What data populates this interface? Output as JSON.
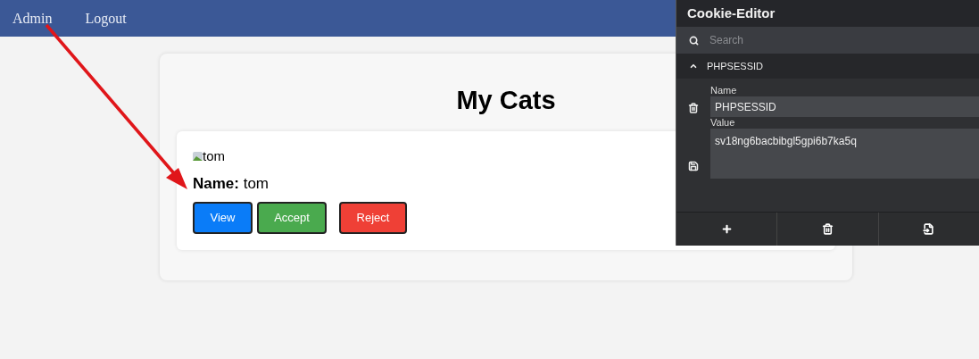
{
  "nav": [
    {
      "label": "Admin"
    },
    {
      "label": "Logout"
    }
  ],
  "page": {
    "title": "My Cats"
  },
  "cats": [
    {
      "image_alt": "tom",
      "name_line": "**Name:** tom",
      "buttons": [
        {
          "label": "View",
          "kind": "view"
        },
        {
          "label": "Accept",
          "kind": "accept"
        },
        {
          "label": "Reject",
          "kind": "reject"
        }
      ]
    }
  ],
  "cookie_editor": {
    "title": "Cookie-Editor",
    "search": {
      "placeholder": "Search"
    },
    "cookies": [
      {
        "name": "PHPSESSID",
        "expanded": true,
        "name_label": "Name",
        "name_value": "PHPSESSID",
        "value_label": "Value",
        "value": "sv18ng6bacbibgl5gpi6b7ka5q"
      }
    ]
  }
}
